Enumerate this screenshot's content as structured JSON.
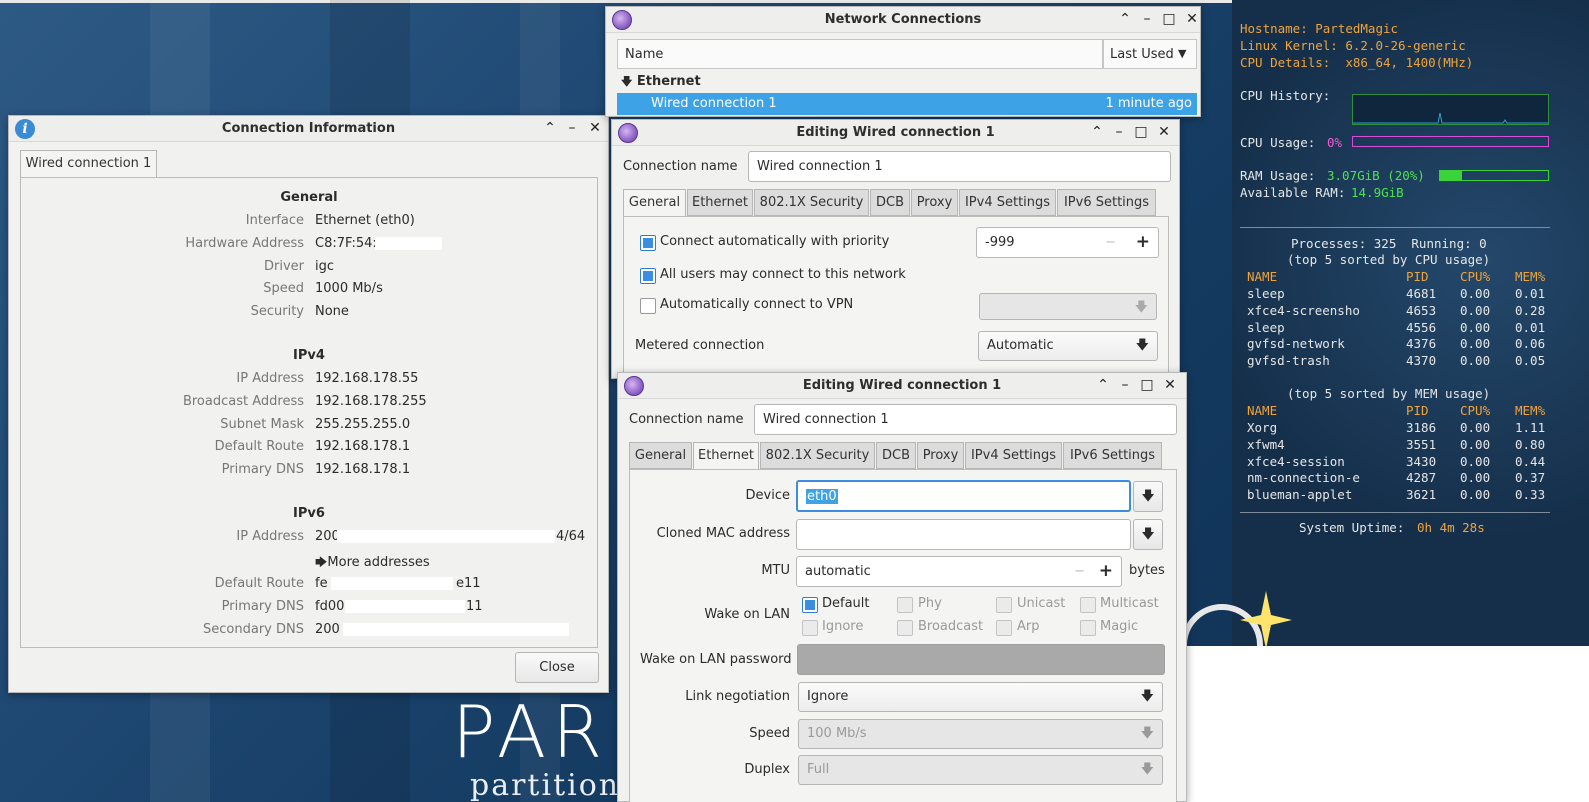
{
  "colors": {
    "accent": "#3ea3e6",
    "conky_label": "#f0a33a",
    "conky_value": "#4fe24f",
    "conky_cpu": "#f05ad6"
  },
  "desktop": {
    "logo": "PAR",
    "logo_sub": "partition"
  },
  "conky": {
    "hostname": "Hostname: PartedMagic",
    "kernel": "Linux Kernel: 6.2.0-26-generic",
    "cpu_details": "CPU Details:  x86_64, 1400(MHz)",
    "cpu_history_label": "CPU History:",
    "cpu_usage_label": "CPU Usage:",
    "cpu_usage_value": "0%",
    "ram_usage_label": "RAM Usage:",
    "ram_usage_value": "3.07GiB (20%)",
    "ram_fraction": 0.2,
    "available_ram_label": "Available RAM:",
    "available_ram_value": "14.9GiB",
    "processes_line": "Processes: 325  Running: 0",
    "cpu_sort_title": "(top 5 sorted by CPU usage)",
    "mem_sort_title": "(top 5 sorted by MEM usage)",
    "col_name": "NAME",
    "col_pid": "PID",
    "col_cpu": "CPU%",
    "col_mem": "MEM%",
    "cpu_procs": [
      {
        "name": "sleep",
        "pid": "4681",
        "cpu": "0.00",
        "mem": "0.01"
      },
      {
        "name": "xfce4-screensho",
        "pid": "4653",
        "cpu": "0.00",
        "mem": "0.28"
      },
      {
        "name": "sleep",
        "pid": "4556",
        "cpu": "0.00",
        "mem": "0.01"
      },
      {
        "name": "gvfsd-network",
        "pid": "4376",
        "cpu": "0.00",
        "mem": "0.06"
      },
      {
        "name": "gvfsd-trash",
        "pid": "4370",
        "cpu": "0.00",
        "mem": "0.05"
      }
    ],
    "mem_procs": [
      {
        "name": "Xorg",
        "pid": "3186",
        "cpu": "0.00",
        "mem": "1.11"
      },
      {
        "name": "xfwm4",
        "pid": "3551",
        "cpu": "0.00",
        "mem": "0.80"
      },
      {
        "name": "xfce4-session",
        "pid": "3430",
        "cpu": "0.00",
        "mem": "0.44"
      },
      {
        "name": "nm-connection-e",
        "pid": "4287",
        "cpu": "0.00",
        "mem": "0.37"
      },
      {
        "name": "blueman-applet",
        "pid": "3621",
        "cpu": "0.00",
        "mem": "0.33"
      }
    ],
    "uptime_label": "System Uptime:",
    "uptime_value": "0h 4m 28s"
  },
  "connection_info": {
    "title": "Connection Information",
    "tab": "Wired connection 1",
    "general": {
      "heading": "General",
      "interface_label": "Interface",
      "interface": "Ethernet (eth0)",
      "hw_label": "Hardware Address",
      "hw": "C8:7F:54:",
      "driver_label": "Driver",
      "driver": "igc",
      "speed_label": "Speed",
      "speed": "1000 Mb/s",
      "security_label": "Security",
      "security": "None"
    },
    "ipv4": {
      "heading": "IPv4",
      "ip_label": "IP Address",
      "ip": "192.168.178.55",
      "bcast_label": "Broadcast Address",
      "bcast": "192.168.178.255",
      "mask_label": "Subnet Mask",
      "mask": "255.255.255.0",
      "route_label": "Default Route",
      "route": "192.168.178.1",
      "dns_label": "Primary DNS",
      "dns": "192.168.178.1"
    },
    "ipv6": {
      "heading": "IPv6",
      "ip_label": "IP Address",
      "ip_start": "200",
      "ip_end": "4/64",
      "more": "More addresses",
      "route_label": "Default Route",
      "route_start": "fe",
      "route_end": "e11",
      "dns_label": "Primary DNS",
      "dns_start": "fd00",
      "dns_end": "11",
      "dns2_label": "Secondary DNS",
      "dns2_start": "200"
    },
    "close": "Close"
  },
  "network_connections": {
    "title": "Network Connections",
    "col_name": "Name",
    "col_last_used": "Last Used",
    "group": "Ethernet",
    "row_name": "Wired connection 1",
    "row_last_used": "1 minute ago"
  },
  "edit1": {
    "title": "Editing Wired connection 1",
    "conn_name_label": "Connection name",
    "conn_name": "Wired connection 1",
    "tabs": [
      "General",
      "Ethernet",
      "802.1X Security",
      "DCB",
      "Proxy",
      "IPv4 Settings",
      "IPv6 Settings"
    ],
    "auto_connect": "Connect automatically with priority",
    "priority": "-999",
    "all_users": "All users may connect to this network",
    "auto_vpn": "Automatically connect to VPN",
    "metered_label": "Metered connection",
    "metered": "Automatic"
  },
  "edit2": {
    "title": "Editing Wired connection 1",
    "conn_name_label": "Connection name",
    "conn_name": "Wired connection 1",
    "tabs": [
      "General",
      "Ethernet",
      "802.1X Security",
      "DCB",
      "Proxy",
      "IPv4 Settings",
      "IPv6 Settings"
    ],
    "device_label": "Device",
    "device": "eth0",
    "cloned_label": "Cloned MAC address",
    "cloned": "",
    "mtu_label": "MTU",
    "mtu": "automatic",
    "mtu_unit": "bytes",
    "wol_label": "Wake on LAN",
    "wol": {
      "default": "Default",
      "phy": "Phy",
      "unicast": "Unicast",
      "multicast": "Multicast",
      "ignore": "Ignore",
      "broadcast": "Broadcast",
      "arp": "Arp",
      "magic": "Magic"
    },
    "wol_pw_label": "Wake on LAN password",
    "link_label": "Link negotiation",
    "link": "Ignore",
    "speed_label": "Speed",
    "speed": "100 Mb/s",
    "duplex_label": "Duplex",
    "duplex": "Full"
  }
}
